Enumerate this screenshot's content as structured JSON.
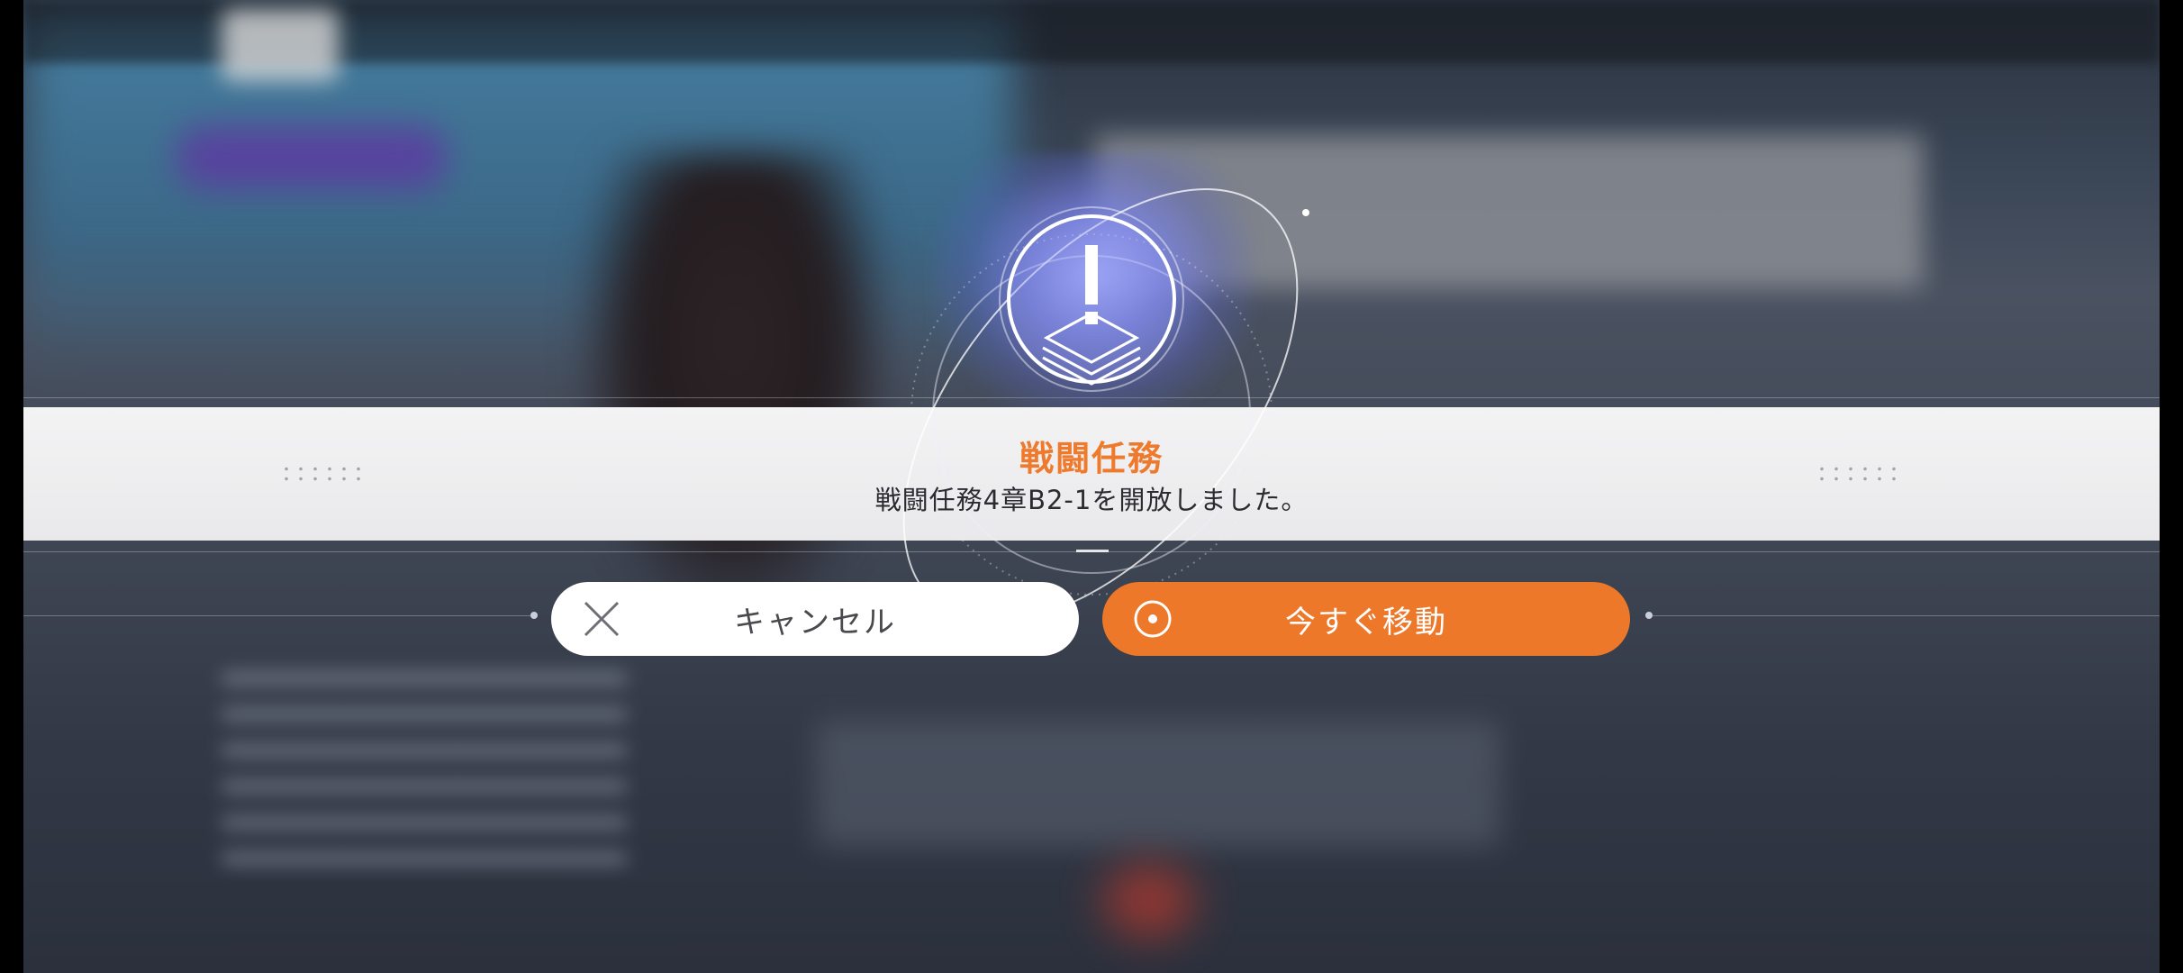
{
  "dialog": {
    "title": "戦闘任務",
    "message": "戦闘任務4章B2-1を開放しました。",
    "icon": "warning-layers-icon"
  },
  "buttons": {
    "cancel": {
      "label": "キャンセル",
      "icon": "close-x-icon"
    },
    "go": {
      "label": "今すぐ移動",
      "icon": "target-circle-icon"
    }
  },
  "colors": {
    "accent": "#ee782a",
    "title": "#ee7a2d",
    "banner": "#ececee",
    "cancel_bg": "#ffffff",
    "text": "#2c2c30"
  }
}
